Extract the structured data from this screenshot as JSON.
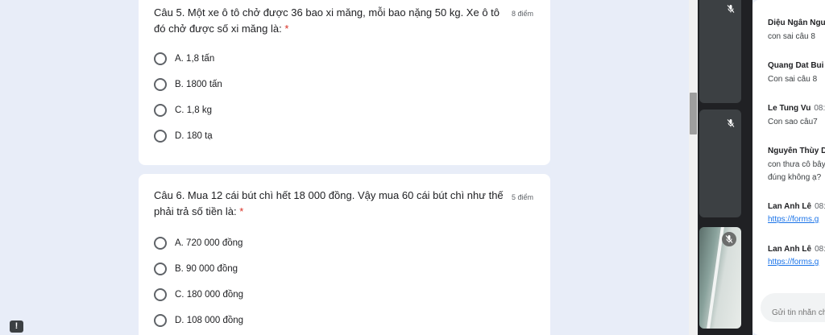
{
  "questions": [
    {
      "title": "Câu 5. Một xe ô tô chở được 36 bao xi măng, mỗi bao nặng 50 kg. Xe ô tô đó chở được số xi măng là:",
      "required_mark": "*",
      "points": "8 điểm",
      "options": [
        "A. 1,8 tấn",
        "B. 1800 tấn",
        "C. 1,8 kg",
        "D. 180 tạ"
      ]
    },
    {
      "title": "Câu 6. Mua 12 cái bút chì hết 18 000 đồng. Vậy mua 60 cái bút chì như thế phải trả số tiền là:",
      "required_mark": "*",
      "points": "5 điểm",
      "options": [
        "A. 720 000 đồng",
        "B. 90 000 đồng",
        "C. 180 000 đồng",
        "D. 108 000 đồng"
      ]
    }
  ],
  "feedback_button": "!",
  "chat": {
    "messages": [
      {
        "sender": "Diệu Ngân Ngu",
        "time": "",
        "text": "con sai câu 8"
      },
      {
        "sender": "Quang Dat Bui",
        "time": "",
        "text": "Con sai câu 8"
      },
      {
        "sender": "Le Tung Vu",
        "time": "08:",
        "text": "Con sao câu7"
      },
      {
        "sender": "Nguyễn Thùy D",
        "time": "",
        "text": "con thưa cô bây",
        "text2": "đúng không ạ?"
      },
      {
        "sender": "Lan Anh Lê",
        "time": "08:",
        "link": "https://forms.g"
      },
      {
        "sender": "Lan Anh Lê",
        "time": "08:",
        "link": "https://forms.g"
      }
    ],
    "input_placeholder": "Gửi tin nhắn ch"
  },
  "colors": {
    "page_bg": "#e8edf8",
    "required": "#d93025",
    "link": "#1a73e8",
    "video_bg": "#202124"
  },
  "icons": {
    "muted_mic": "mic-off-icon",
    "feedback": "exclamation-icon"
  }
}
